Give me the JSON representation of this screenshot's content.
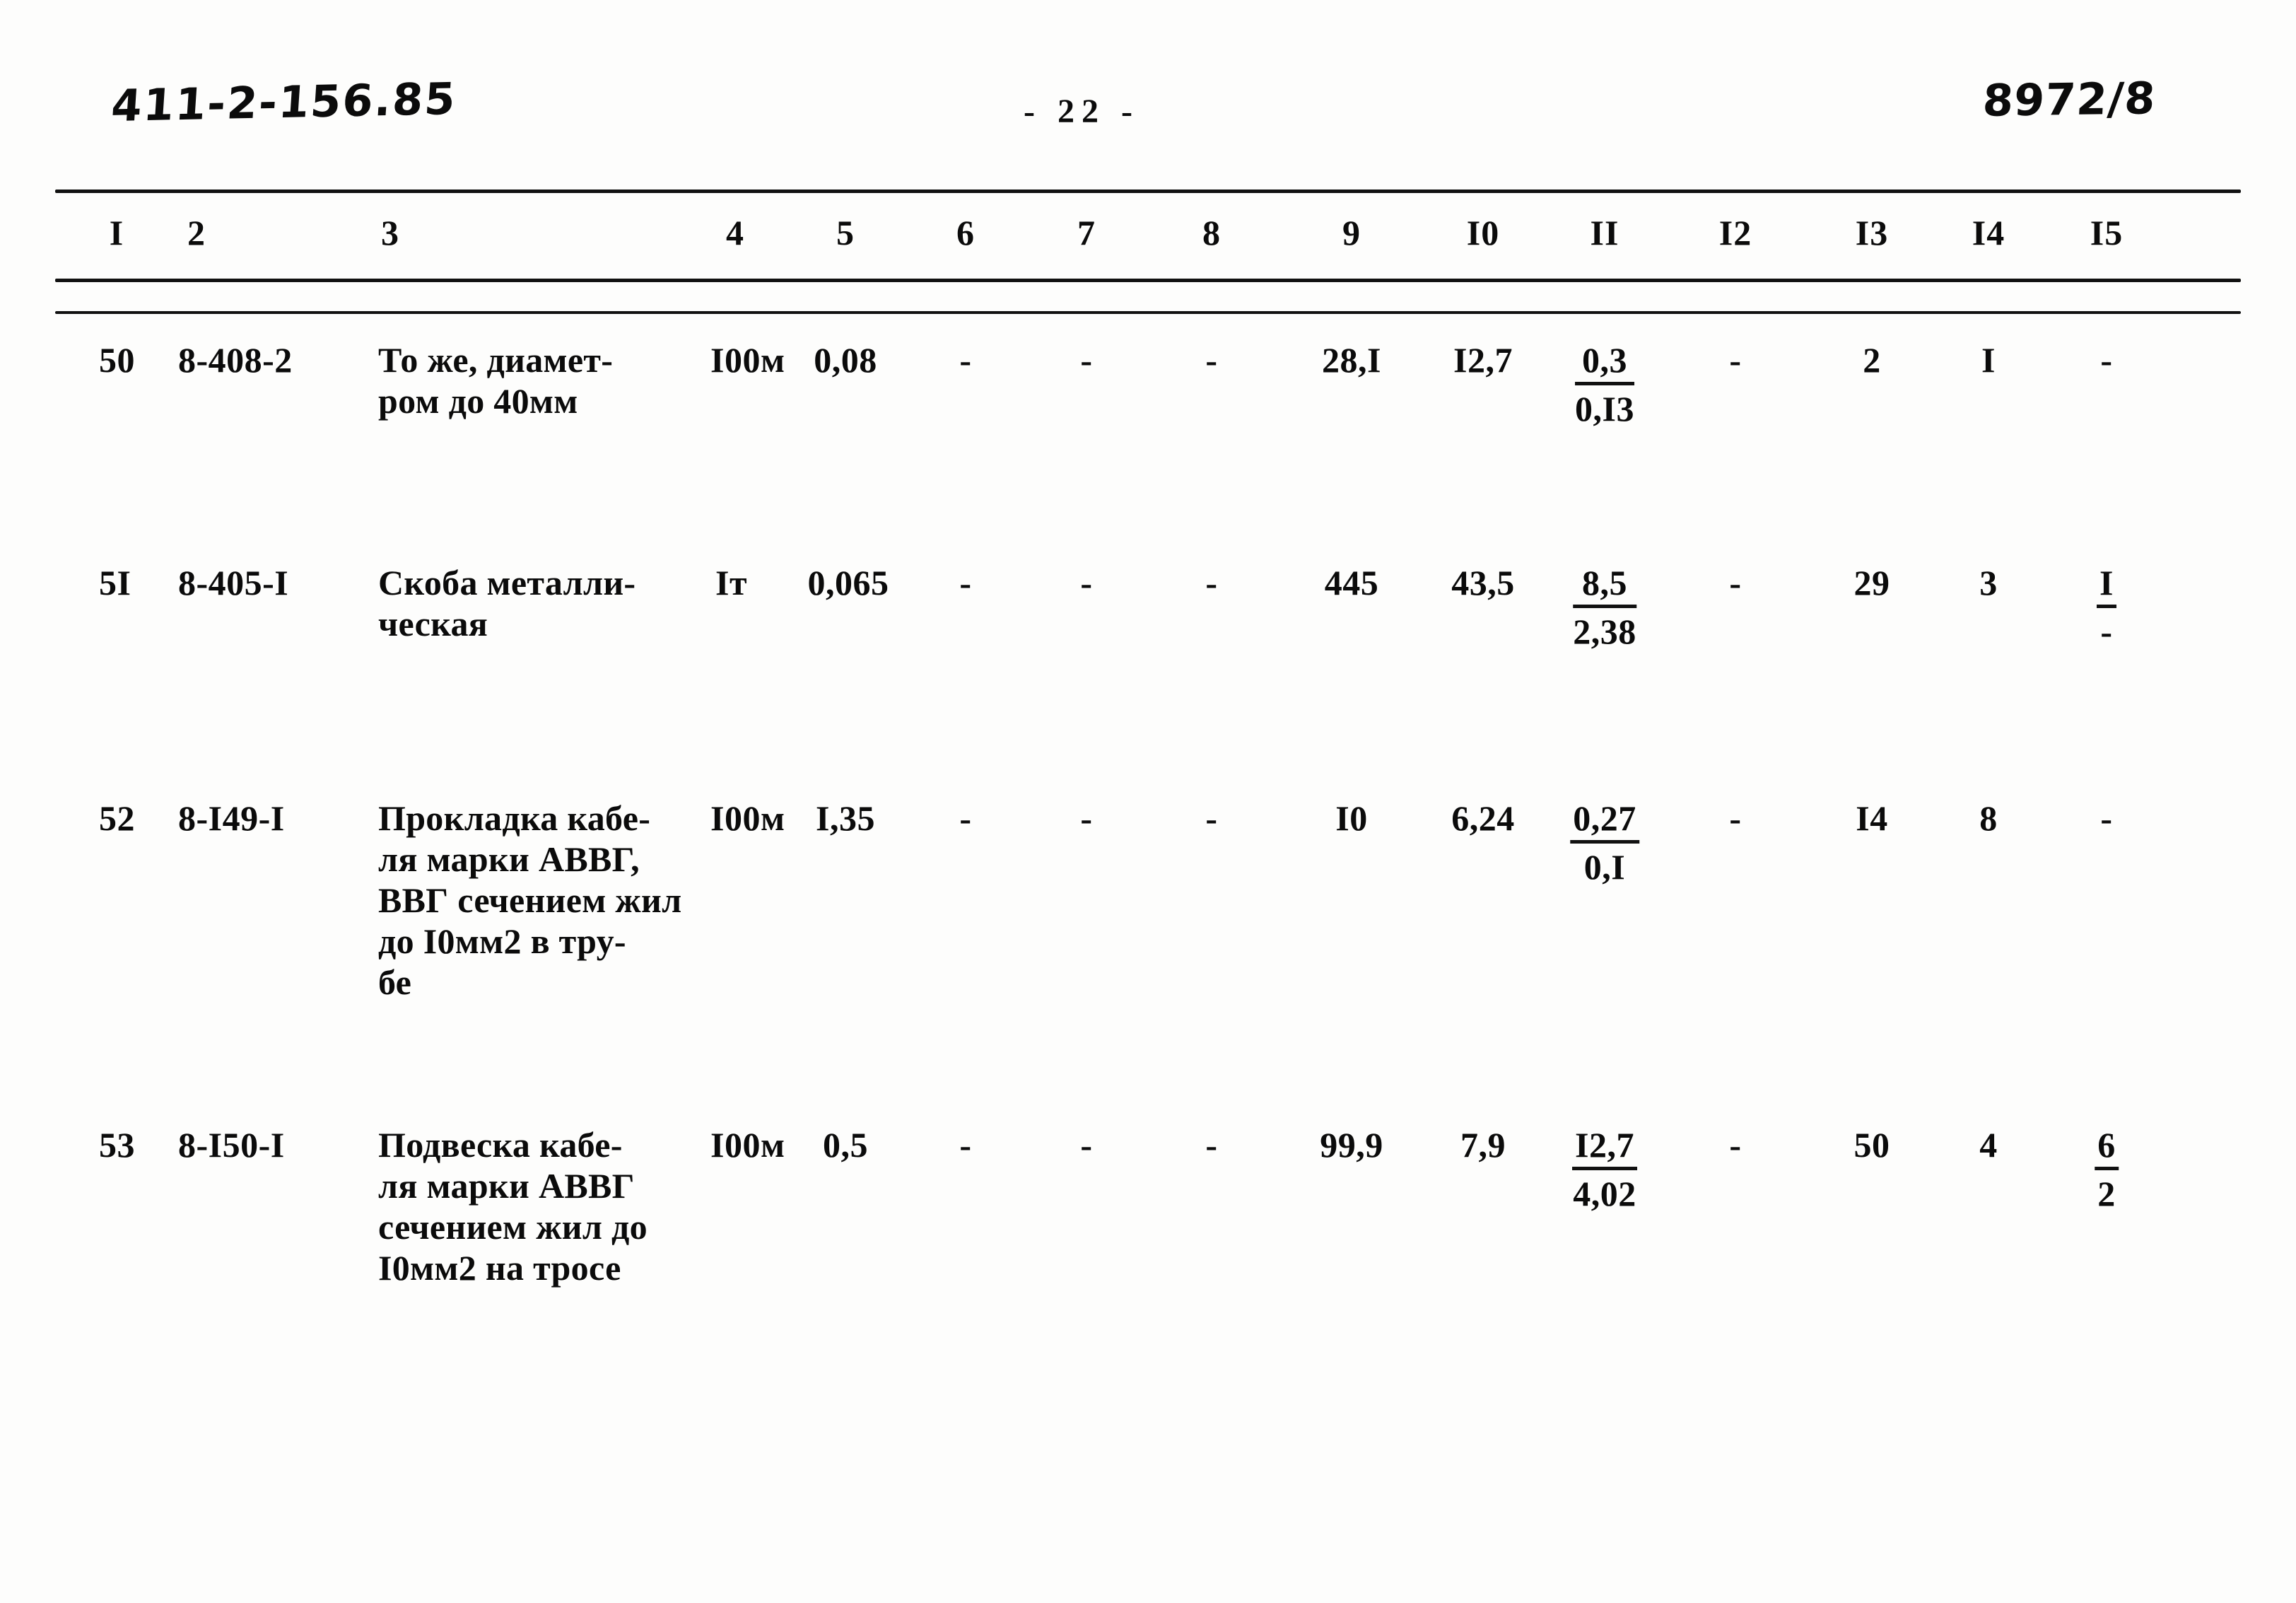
{
  "header": {
    "doc_code": "411-2-156.85",
    "page_label": "- 22 -",
    "sheet_code": "8972/8"
  },
  "table": {
    "column_numbers": [
      "I",
      "2",
      "3",
      "4",
      "5",
      "6",
      "7",
      "8",
      "9",
      "I0",
      "II",
      "I2",
      "I3",
      "I4",
      "I5"
    ],
    "rows": [
      {
        "no": "50",
        "code": "8-408-2",
        "description": [
          "То же, диамет-",
          "ром до 40мм"
        ],
        "unit": "I00м",
        "c5": "0,08",
        "c6": "-",
        "c7": "-",
        "c8": "-",
        "c9": "28,I",
        "c10": "I2,7",
        "c11_top": "0,3",
        "c11_bot": "0,I3",
        "c12": "-",
        "c13": "2",
        "c14": "I",
        "c15": "-"
      },
      {
        "no": "5I",
        "code": "8-405-I",
        "description": [
          "Скоба металли-",
          "ческая"
        ],
        "unit": "Iт",
        "c5": "0,065",
        "c6": "-",
        "c7": "-",
        "c8": "-",
        "c9": "445",
        "c10": "43,5",
        "c11_top": "8,5",
        "c11_bot": "2,38",
        "c12": "-",
        "c13": "29",
        "c14": "3",
        "c15_top": "I",
        "c15_bot": "-"
      },
      {
        "no": "52",
        "code": "8-I49-I",
        "description": [
          "Прокладка кабе-",
          "ля марки АВВГ,",
          "ВВГ сечением жил",
          "до I0мм2 в тру-",
          "бе"
        ],
        "unit": "I00м",
        "c5": "I,35",
        "c6": "-",
        "c7": "-",
        "c8": "-",
        "c9": "I0",
        "c10": "6,24",
        "c11_top": "0,27",
        "c11_bot": "0,I",
        "c12": "-",
        "c13": "I4",
        "c14": "8",
        "c15": "-"
      },
      {
        "no": "53",
        "code": "8-I50-I",
        "description": [
          "Подвеска кабе-",
          "ля марки АВВГ",
          "сечением жил до",
          "I0мм2 на тросе"
        ],
        "unit": "I00м",
        "c5": "0,5",
        "c6": "-",
        "c7": "-",
        "c8": "-",
        "c9": "99,9",
        "c10": "7,9",
        "c11_top": "I2,7",
        "c11_bot": "4,02",
        "c12": "-",
        "c13": "50",
        "c14": "4",
        "c15_top": "6",
        "c15_bot": "2"
      }
    ]
  }
}
